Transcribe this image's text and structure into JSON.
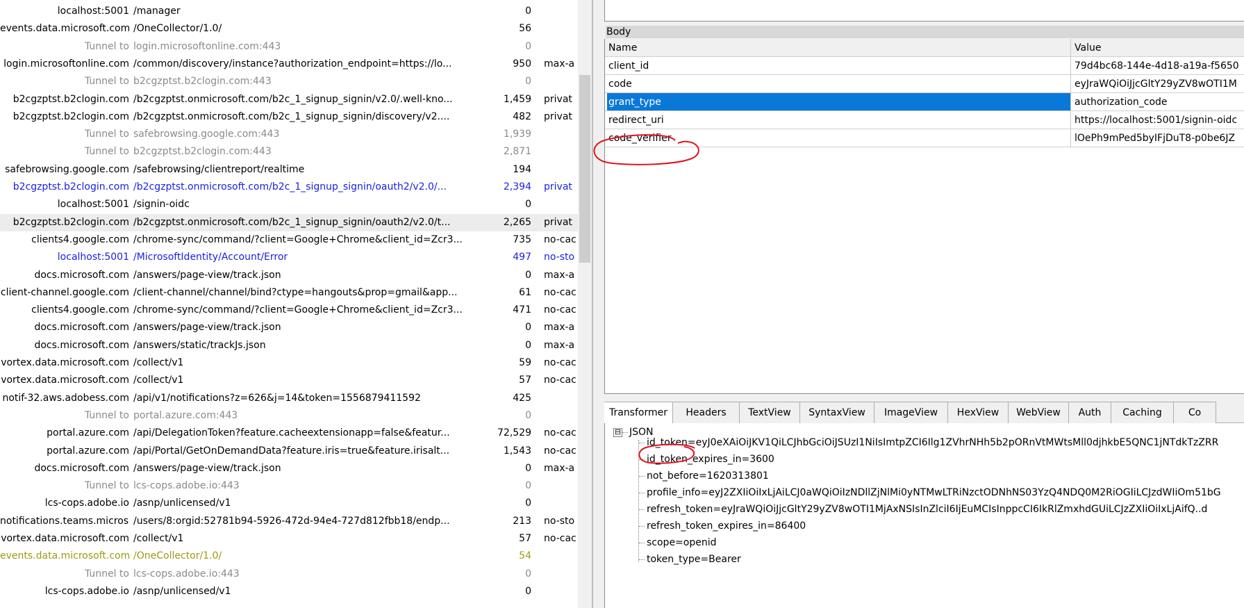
{
  "sessions": [
    {
      "host": "localhost:5001",
      "url": "/manager",
      "body": "0",
      "caching": "",
      "style": "normal"
    },
    {
      "host": "events.data.microsoft.com",
      "url": "/OneCollector/1.0/",
      "body": "56",
      "caching": "",
      "style": "normal"
    },
    {
      "host": "Tunnel to",
      "url": "login.microsoftonline.com:443",
      "body": "0",
      "caching": "",
      "style": "gray"
    },
    {
      "host": "login.microsoftonline.com",
      "url": "/common/discovery/instance?authorization_endpoint=https://lo...",
      "body": "950",
      "caching": "max-a",
      "style": "normal"
    },
    {
      "host": "Tunnel to",
      "url": "b2cgzptst.b2clogin.com:443",
      "body": "0",
      "caching": "",
      "style": "gray"
    },
    {
      "host": "b2cgzptst.b2clogin.com",
      "url": "/b2cgzptst.onmicrosoft.com/b2c_1_signup_signin/v2.0/.well-kno...",
      "body": "1,459",
      "caching": "privat",
      "style": "normal"
    },
    {
      "host": "b2cgzptst.b2clogin.com",
      "url": "/b2cgzptst.onmicrosoft.com/b2c_1_signup_signin/discovery/v2....",
      "body": "482",
      "caching": "privat",
      "style": "normal"
    },
    {
      "host": "Tunnel to",
      "url": "safebrowsing.google.com:443",
      "body": "1,939",
      "caching": "",
      "style": "gray"
    },
    {
      "host": "Tunnel to",
      "url": "b2cgzptst.b2clogin.com:443",
      "body": "2,871",
      "caching": "",
      "style": "gray"
    },
    {
      "host": "safebrowsing.google.com",
      "url": "/safebrowsing/clientreport/realtime",
      "body": "194",
      "caching": "",
      "style": "normal"
    },
    {
      "host": "b2cgzptst.b2clogin.com",
      "url": "/b2cgzptst.onmicrosoft.com/b2c_1_signup_signin/oauth2/v2.0/...",
      "body": "2,394",
      "caching": "privat",
      "style": "blue"
    },
    {
      "host": "localhost:5001",
      "url": "/signin-oidc",
      "body": "0",
      "caching": "",
      "style": "normal"
    },
    {
      "host": "b2cgzptst.b2clogin.com",
      "url": "/b2cgzptst.onmicrosoft.com/b2c_1_signup_signin/oauth2/v2.0/t...",
      "body": "2,265",
      "caching": "privat",
      "style": "sel"
    },
    {
      "host": "clients4.google.com",
      "url": "/chrome-sync/command/?client=Google+Chrome&client_id=Zcr3...",
      "body": "735",
      "caching": "no-cac",
      "style": "normal"
    },
    {
      "host": "localhost:5001",
      "url": "/MicrosoftIdentity/Account/Error",
      "body": "497",
      "caching": "no-sto",
      "style": "blue"
    },
    {
      "host": "docs.microsoft.com",
      "url": "/answers/page-view/track.json",
      "body": "0",
      "caching": "max-a",
      "style": "normal"
    },
    {
      "host": "client-channel.google.com",
      "url": "/client-channel/channel/bind?ctype=hangouts&prop=gmail&app...",
      "body": "61",
      "caching": "no-cac",
      "style": "normal"
    },
    {
      "host": "clients4.google.com",
      "url": "/chrome-sync/command/?client=Google+Chrome&client_id=Zcr3...",
      "body": "471",
      "caching": "no-cac",
      "style": "normal"
    },
    {
      "host": "docs.microsoft.com",
      "url": "/answers/page-view/track.json",
      "body": "0",
      "caching": "max-a",
      "style": "normal"
    },
    {
      "host": "docs.microsoft.com",
      "url": "/answers/static/trackJs.json",
      "body": "0",
      "caching": "max-a",
      "style": "normal"
    },
    {
      "host": "vortex.data.microsoft.com",
      "url": "/collect/v1",
      "body": "59",
      "caching": "no-cac",
      "style": "normal"
    },
    {
      "host": "vortex.data.microsoft.com",
      "url": "/collect/v1",
      "body": "57",
      "caching": "no-cac",
      "style": "normal"
    },
    {
      "host": "notif-32.aws.adobess.com",
      "url": "/api/v1/notifications?z=626&j=14&token=1556879411592",
      "body": "425",
      "caching": "",
      "style": "normal"
    },
    {
      "host": "Tunnel to",
      "url": "portal.azure.com:443",
      "body": "0",
      "caching": "",
      "style": "gray"
    },
    {
      "host": "portal.azure.com",
      "url": "/api/DelegationToken?feature.cacheextensionapp=false&featur...",
      "body": "72,529",
      "caching": "no-cac",
      "style": "normal"
    },
    {
      "host": "portal.azure.com",
      "url": "/api/Portal/GetOnDemandData?feature.iris=true&feature.irisalt...",
      "body": "1,543",
      "caching": "no-cac",
      "style": "normal"
    },
    {
      "host": "docs.microsoft.com",
      "url": "/answers/page-view/track.json",
      "body": "0",
      "caching": "max-a",
      "style": "normal"
    },
    {
      "host": "Tunnel to",
      "url": "lcs-cops.adobe.io:443",
      "body": "0",
      "caching": "",
      "style": "gray"
    },
    {
      "host": "lcs-cops.adobe.io",
      "url": "/asnp/unlicensed/v1",
      "body": "0",
      "caching": "",
      "style": "normal"
    },
    {
      "host": "notifications.teams.microsoft.com",
      "url": "/users/8:orgid:52781b94-5926-472d-94e4-727d812fbb18/endp...",
      "body": "213",
      "caching": "no-sto",
      "style": "normal"
    },
    {
      "host": "vortex.data.microsoft.com",
      "url": "/collect/v1",
      "body": "57",
      "caching": "no-cac",
      "style": "normal"
    },
    {
      "host": "events.data.microsoft.com",
      "url": "/OneCollector/1.0/",
      "body": "54",
      "caching": "",
      "style": "olive"
    },
    {
      "host": "Tunnel to",
      "url": "lcs-cops.adobe.io:443",
      "body": "0",
      "caching": "",
      "style": "gray"
    },
    {
      "host": "lcs-cops.adobe.io",
      "url": "/asnp/unlicensed/v1",
      "body": "0",
      "caching": "",
      "style": "normal"
    }
  ],
  "body_panel": {
    "label": "Body",
    "header": {
      "name": "Name",
      "value": "Value"
    },
    "rows": [
      {
        "name": "client_id",
        "value": "79d4bc68-144e-4d18-a19a-f5650"
      },
      {
        "name": "code",
        "value": "eyJraWQiOiJjcGltY29yZV8wOTI1M"
      },
      {
        "name": "grant_type",
        "value": "authorization_code"
      },
      {
        "name": "redirect_uri",
        "value": "https://localhost:5001/signin-oidc"
      },
      {
        "name": "code_verifier",
        "value": "lOePh9mPed5byIFjDuT8-p0be6JZ"
      }
    ]
  },
  "tabs": [
    "Transformer",
    "Headers",
    "TextView",
    "SyntaxView",
    "ImageView",
    "HexView",
    "WebView",
    "Auth",
    "Caching",
    "Co"
  ],
  "json_tree": {
    "root": "JSON",
    "expander": "⊟",
    "items": [
      "id_token=eyJ0eXAiOiJKV1QiLCJhbGciOiJSUzI1NiIsImtpZCI6Ilg1ZVhrNHh5b2pORnVtMWtsMll0djhkbE5QNC1jNTdkTzZRR",
      "id_token_expires_in=3600",
      "not_before=1620313801",
      "profile_info=eyJ2ZXIiOiIxLjAiLCJ0aWQiOiIzNDllZjNlMi0yNTMwLTRiNzctODNhNS03YzQ4NDQ0M2RiOGIiLCJzdWIiOm51bG",
      "refresh_token=eyJraWQiOiJjcGltY29yZV8wOTI1MjAxNSIsInZlciI6IjEuMCIsInppcCI6IkRlZmxhdGUiLCJzZXIiOiIxLjAifQ..d",
      "refresh_token_expires_in=86400",
      "scope=openid",
      "token_type=Bearer"
    ]
  },
  "colors": {
    "selection": "#0a78d7",
    "annotation": "#e0141e",
    "link_blue": "#1a20e6",
    "tunnel_gray": "#8a8a8a",
    "olive": "#a09a10"
  }
}
